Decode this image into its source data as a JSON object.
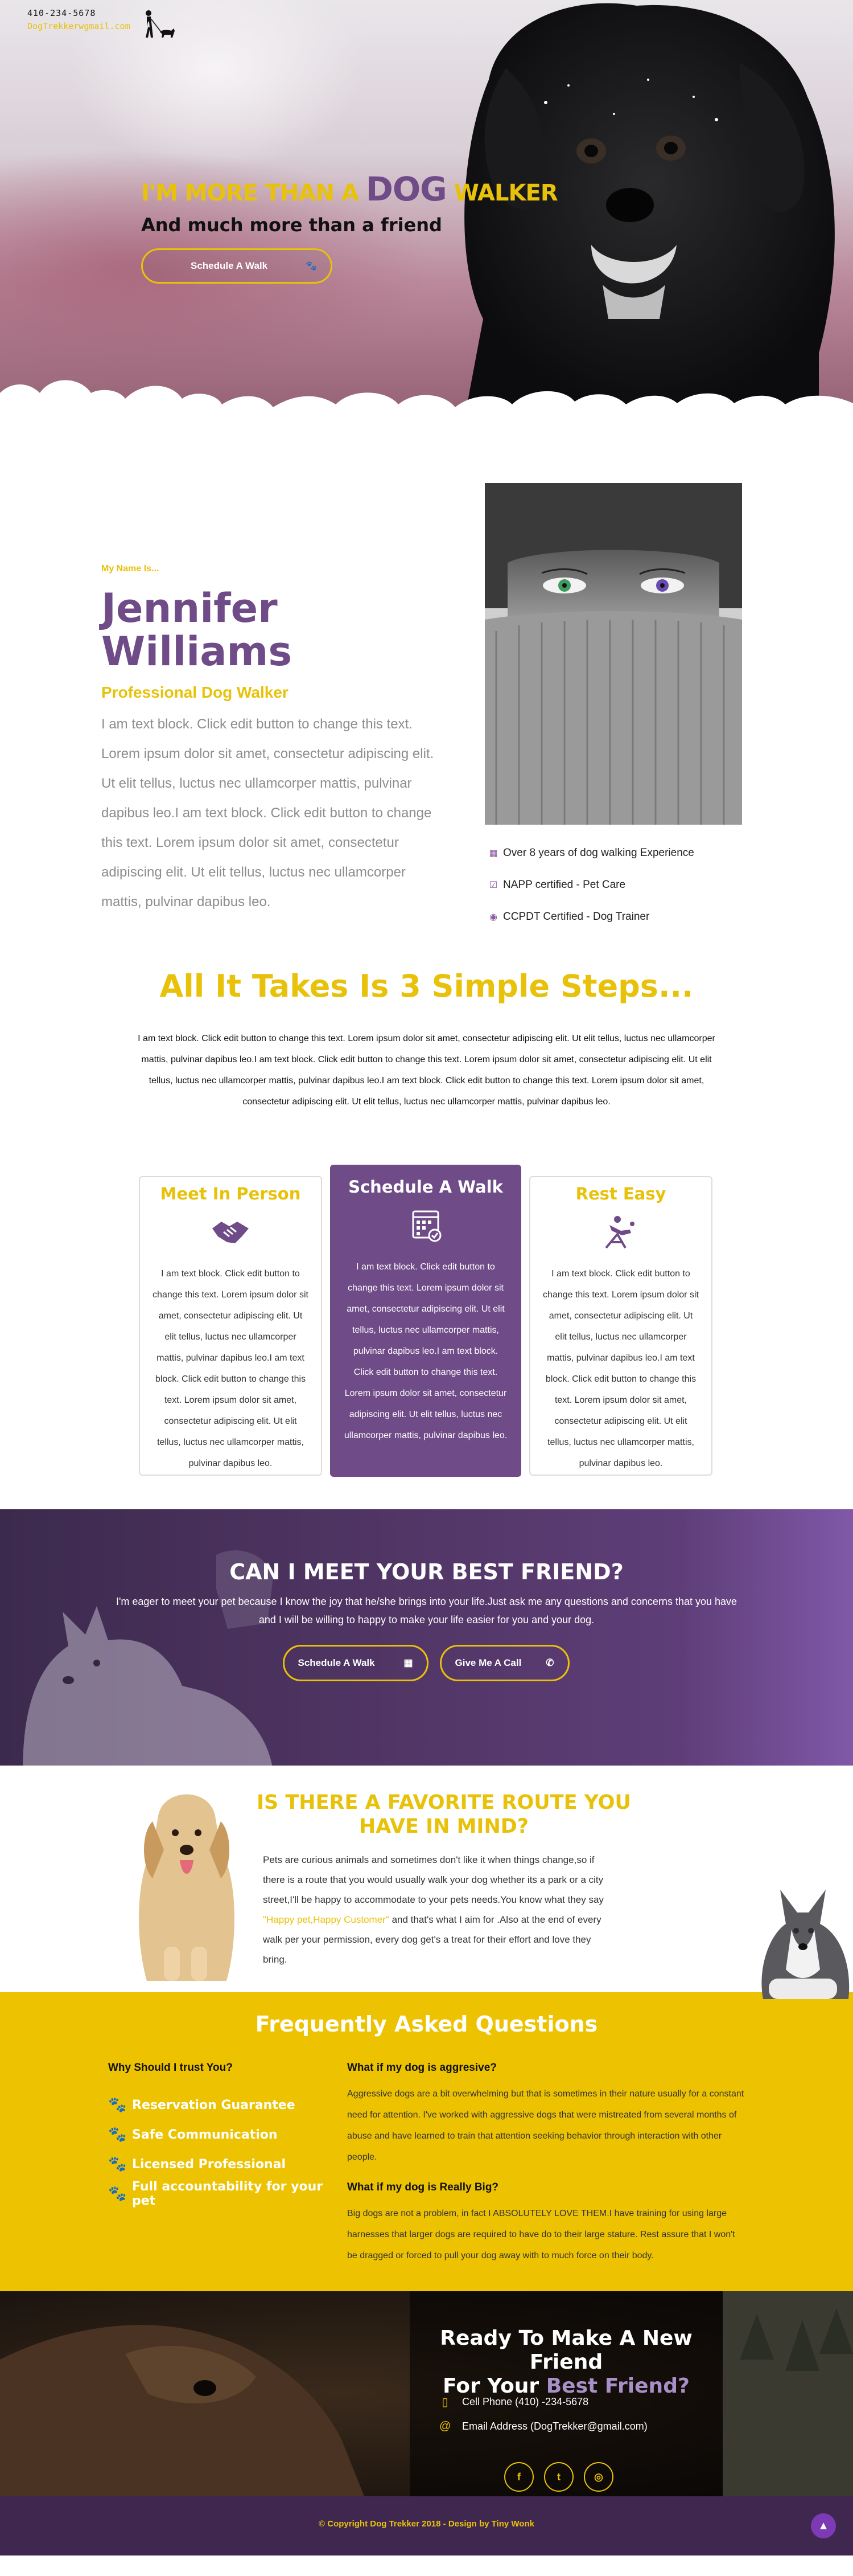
{
  "header": {
    "phone": "410-234-5678",
    "email": "DogTrekkerwgmail.com"
  },
  "hero": {
    "title_pre": "I'M MORE THAN A ",
    "title_big": "DOG",
    "title_post": " WALKER",
    "subtitle": "And much more than a friend",
    "cta_label": "Schedule A Walk"
  },
  "about": {
    "kicker": "My Name Is...",
    "first_name": "Jennifer",
    "last_name": "Williams",
    "profession": "Professional Dog Walker",
    "text": "I am text block. Click edit button to change this text. Lorem ipsum dolor sit amet, consectetur adipiscing elit. Ut elit tellus, luctus nec ullamcorper mattis, pulvinar dapibus leo.I am text block. Click edit button to change this text. Lorem ipsum dolor sit amet, consectetur adipiscing elit. Ut elit tellus, luctus nec ullamcorper mattis, pulvinar dapibus leo.",
    "credentials": [
      {
        "icon": "calendar-icon",
        "text": "Over 8 years of dog walking Experience"
      },
      {
        "icon": "check-square-icon",
        "text": "NAPP certified - Pet Care"
      },
      {
        "icon": "circle-dot-icon",
        "text": "CCPDT Certified - Dog Trainer"
      }
    ]
  },
  "steps": {
    "title": "All It Takes Is 3 Simple Steps...",
    "intro": "I am text block. Click edit button to change this text. Lorem ipsum dolor sit amet, consectetur adipiscing elit. Ut elit tellus, luctus nec ullamcorper mattis, pulvinar dapibus leo.I am text block. Click edit button to change this text. Lorem ipsum dolor sit amet, consectetur adipiscing elit. Ut elit tellus, luctus nec ullamcorper mattis, pulvinar dapibus leo.I am text block. Click edit button to change this text. Lorem ipsum dolor sit amet, consectetur adipiscing elit. Ut elit tellus, luctus nec ullamcorper mattis, pulvinar dapibus leo.",
    "cards": [
      {
        "title": "Meet In Person",
        "icon": "handshake-icon",
        "text": "I am text block. Click edit button to change this text. Lorem ipsum dolor sit amet, consectetur adipiscing elit. Ut elit tellus, luctus nec ullamcorper mattis, pulvinar dapibus leo.I am text block. Click edit button to change this text. Lorem ipsum dolor sit amet, consectetur adipiscing elit. Ut elit tellus, luctus nec ullamcorper mattis, pulvinar dapibus leo."
      },
      {
        "title": "Schedule A Walk",
        "icon": "calendar-check-icon",
        "text": "I am text block. Click edit button to change this text. Lorem ipsum dolor sit amet, consectetur adipiscing elit. Ut elit tellus, luctus nec ullamcorper mattis, pulvinar dapibus leo.I am text block. Click edit button to change this text. Lorem ipsum dolor sit amet, consectetur adipiscing elit. Ut elit tellus, luctus nec ullamcorper mattis, pulvinar dapibus leo."
      },
      {
        "title": "Rest Easy",
        "icon": "relax-chair-icon",
        "text": "I am text block. Click edit button to change this text. Lorem ipsum dolor sit amet, consectetur adipiscing elit. Ut elit tellus, luctus nec ullamcorper mattis, pulvinar dapibus leo.I am text block. Click edit button to change this text. Lorem ipsum dolor sit amet, consectetur adipiscing elit. Ut elit tellus, luctus nec ullamcorper mattis, pulvinar dapibus leo."
      }
    ]
  },
  "meet": {
    "title": "CAN I MEET YOUR BEST FRIEND?",
    "text": "I'm eager to meet your pet because I know the joy that he/she brings into your life.Just ask me any questions and concerns that you have and I will be willing to happy to make your life easier for you and your dog.",
    "btn_walk": "Schedule A Walk",
    "btn_call": "Give Me A Call"
  },
  "route": {
    "title": "IS THERE A FAVORITE ROUTE YOU HAVE IN MIND?",
    "text_before": "Pets are curious animals and sometimes don't like it when things change,so if there is a route that you would usually walk your dog whether its a park or a city street,I'll be happy to accommodate to your pets needs.You know what they say ",
    "highlight": "\"Happy pet,Happy Customer\"",
    "text_after": " and that's what I aim for .Also at the end of every walk per your permission, every dog get's a treat for their effort and love they bring."
  },
  "faq": {
    "title": "Frequently Asked Questions",
    "left_heading": "Why Should I trust You?",
    "reasons": [
      "Reservation Guarantee",
      "Safe Communication",
      "Licensed Professional",
      "Full accountability for your pet"
    ],
    "q1": "What if my dog is aggresive?",
    "a1": "Aggressive dogs are a bit overwhelming but that is sometimes in their nature usually for a constant need for attention. I've worked with aggressive dogs that were mistreated from several months of abuse and have learned to train that attention seeking behavior through interaction with other people.",
    "q2": "What if my dog is Really Big?",
    "a2": "Big dogs are not a problem, in fact I ABSOLUTELY LOVE THEM.I have training for using large harnesses that larger dogs are required to have do to their large stature. Rest assure that I won't be dragged or forced to pull your dog away with to much force on their body."
  },
  "contact": {
    "title_line1": "Ready To Make A New Friend",
    "title_line2_pre": "For Your ",
    "title_line2_hl": "Best Friend?",
    "phone": "Cell Phone (410) -234-5678",
    "email": "Email Address (DogTrekker@gmail.com)",
    "socials": [
      "f",
      "t",
      "ig"
    ]
  },
  "footer": {
    "copyright": "© Copyright Dog Trekker 2018 - Design by Tiny Wonk"
  },
  "colors": {
    "yellow": "#e8c20a",
    "purple": "#6f4b87",
    "faq_bg": "#edc200",
    "footer_bg": "#3f2750"
  }
}
